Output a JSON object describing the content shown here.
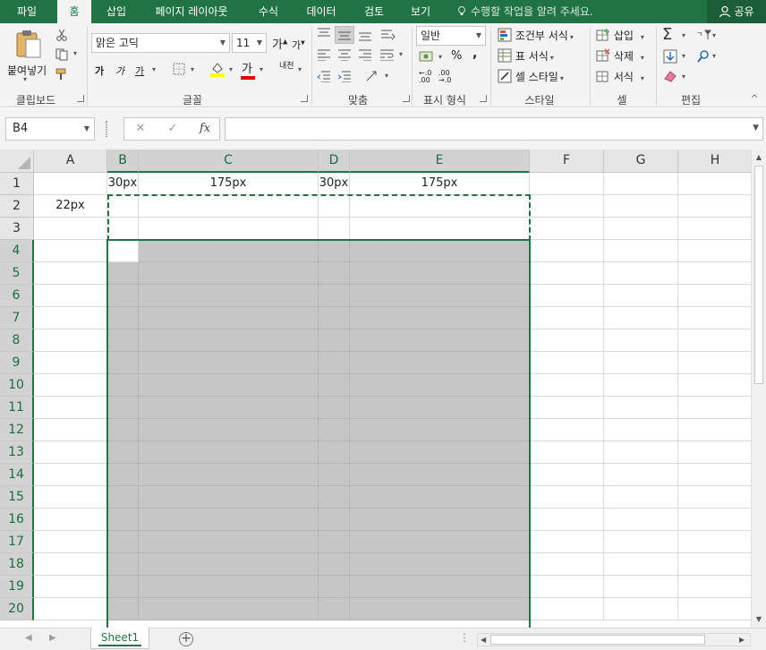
{
  "menubar": {
    "tabs": [
      "파일",
      "홈",
      "삽입",
      "페이지 레이아웃",
      "수식",
      "데이터",
      "검토",
      "보기"
    ],
    "active_tab": "홈",
    "tell_me": "수행할 작업을 알려 주세요.",
    "share": "공유"
  },
  "ribbon": {
    "clipboard": {
      "label": "클립보드",
      "paste": "붙여넣기"
    },
    "font": {
      "label": "글꼴",
      "font_name": "맑은 고딕",
      "font_size": "11",
      "bold": "가",
      "italic": "가",
      "underline": "가",
      "font_color_glyph": "가",
      "phonetic": "내천"
    },
    "alignment": {
      "label": "맞춤"
    },
    "number": {
      "label": "표시 형식",
      "format": "일반",
      "percent": "%",
      "comma": ","
    },
    "styles": {
      "label": "스타일",
      "conditional": "조건부 서식",
      "table": "표 서식",
      "cell_styles": "셀 스타일"
    },
    "cells": {
      "label": "셀",
      "insert": "삽입",
      "delete": "삭제",
      "format": "서식"
    },
    "editing": {
      "label": "편집"
    }
  },
  "formula_bar": {
    "name_box": "B4",
    "cancel": "✕",
    "enter": "✓",
    "fx": "fx",
    "value": ""
  },
  "grid": {
    "columns": [
      "A",
      "B",
      "C",
      "D",
      "E",
      "F",
      "G",
      "H"
    ],
    "selected_columns": [
      "B",
      "C",
      "D",
      "E"
    ],
    "rows": [
      "1",
      "2",
      "3",
      "4",
      "5",
      "6",
      "7",
      "8",
      "9",
      "10",
      "11",
      "12",
      "13",
      "14",
      "15",
      "16",
      "17",
      "18",
      "19",
      "20"
    ],
    "selected_rows_from": 4,
    "cells": {
      "B1": "30px",
      "C1": "175px",
      "D1": "30px",
      "E1": "175px",
      "A2": "22px"
    },
    "active_cell": "B4"
  },
  "sheets": {
    "tabs": [
      "Sheet1"
    ],
    "active": "Sheet1"
  },
  "colors": {
    "accent": "#217346",
    "selection_gray": "#c6c6c6"
  }
}
